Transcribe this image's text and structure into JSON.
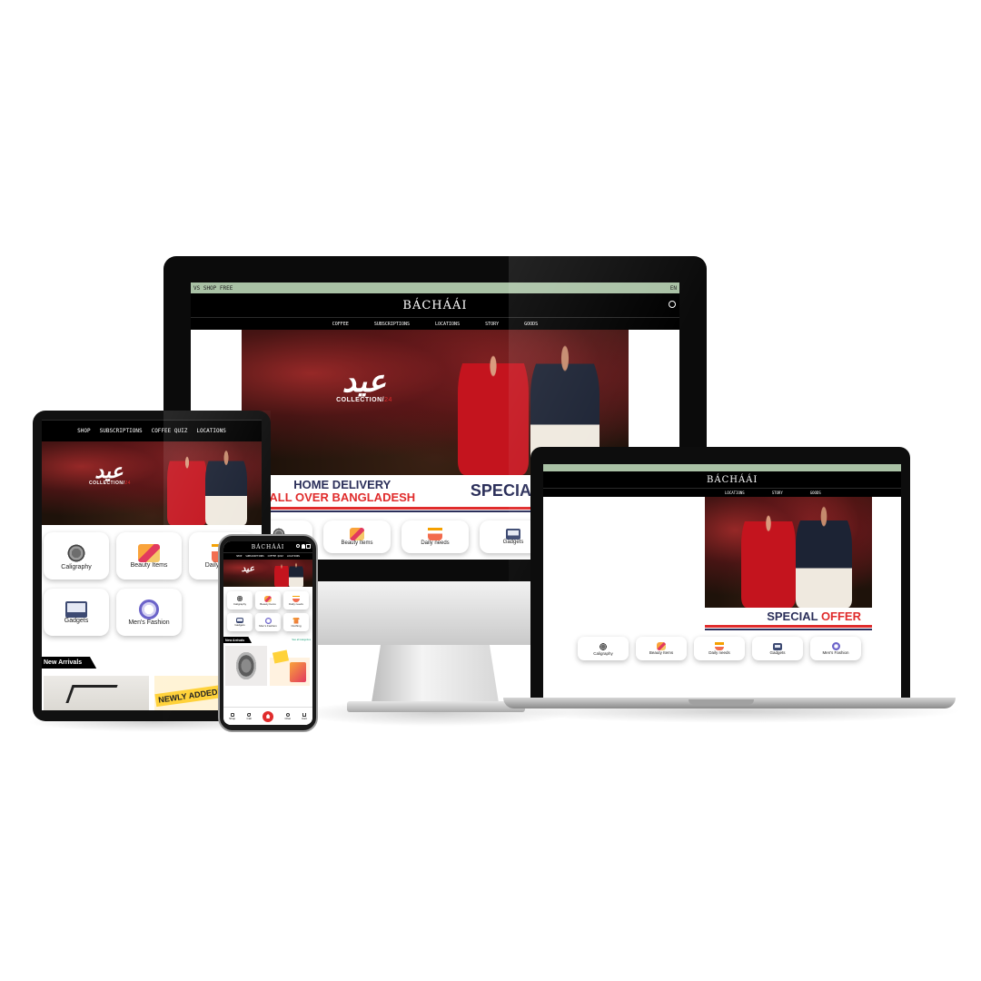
{
  "brand": {
    "name": "BÁCHÁÁI"
  },
  "ticker": {
    "left": "VS SHOP FREE",
    "right": "EN"
  },
  "desktop_nav": [
    "COFFEE",
    "SUBSCRIPTIONS",
    "LOCATIONS",
    "STORY",
    "GOODS"
  ],
  "tablet_nav": [
    "SHOP",
    "SUBSCRIPTIONS",
    "COFFEE QUIZ",
    "LOCATIONS"
  ],
  "phone_nav": [
    "SHOP",
    "SUBSCRIPTIONS",
    "COFFEE QUIZ",
    "LOCATIONS"
  ],
  "hero": {
    "logo_glyph": "عید",
    "collection_label": "COLLECTION/",
    "collection_year": "24"
  },
  "offer": {
    "delivery_line1": "HOME DELIVERY",
    "delivery_line2": "ALL OVER BANGLADESH",
    "special_word1": "SPECIAL",
    "special_word2": "OFFER"
  },
  "categories": [
    {
      "label": "Caligraphy",
      "icon": "calligraphy-icon"
    },
    {
      "label": "Beauty Items",
      "icon": "beauty-icon"
    },
    {
      "label": "Daily needs",
      "icon": "basket-icon"
    },
    {
      "label": "Gadgets",
      "icon": "gadget-icon"
    },
    {
      "label": "Men's Fashion",
      "icon": "watch-icon"
    }
  ],
  "phone_extra_category": "Clothing",
  "new_arrivals": {
    "title": "New Arrivals",
    "see_all": "See all categories",
    "promo": "NEWLY ADDED!"
  },
  "phone_bottom_nav": [
    "Shop",
    "Call",
    "Chat",
    "Cart"
  ],
  "colors": {
    "accent_red": "#e02c2c",
    "navy": "#2b2f5a",
    "ticker_green": "#a9c1a5",
    "black": "#000000"
  }
}
